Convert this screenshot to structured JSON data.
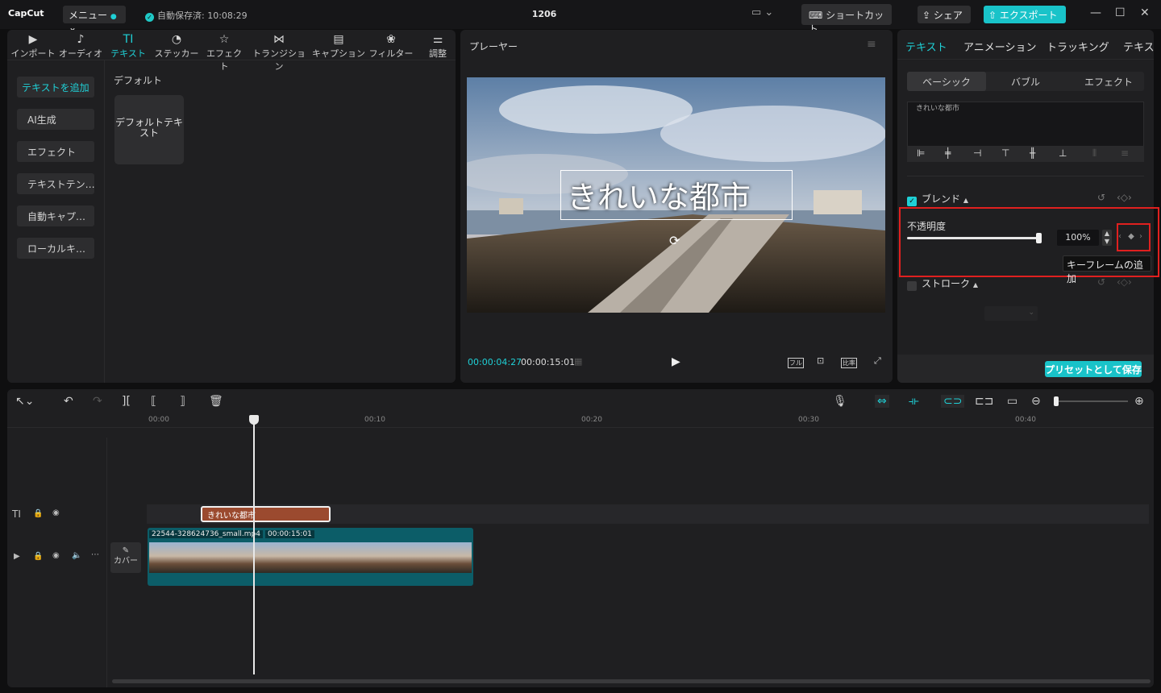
{
  "app": {
    "logo": "CapCut",
    "menu_label": "メニュー",
    "autosave": "自動保存済: 10:08:29",
    "project_title": "1206",
    "shortcut_label": "ショートカット",
    "share_label": "シェア",
    "export_label": "エクスポート"
  },
  "media_tabs": [
    {
      "label": "インポート",
      "icon": "import-icon"
    },
    {
      "label": "オーディオ",
      "icon": "audio-icon"
    },
    {
      "label": "テキスト",
      "icon": "text-icon"
    },
    {
      "label": "ステッカー",
      "icon": "sticker-icon"
    },
    {
      "label": "エフェクト",
      "icon": "effect-icon"
    },
    {
      "label": "トランジション",
      "icon": "transition-icon"
    },
    {
      "label": "キャプション",
      "icon": "caption-icon"
    },
    {
      "label": "フィルター",
      "icon": "filter-icon"
    },
    {
      "label": "調整",
      "icon": "adjust-icon"
    }
  ],
  "sidebar": [
    "テキストを追加",
    "AI生成",
    "エフェクト",
    "テキストテン…",
    "自動キャプ…",
    "ローカルキ…"
  ],
  "text_panel": {
    "section": "デフォルト",
    "card": "デフォルトテキスト"
  },
  "player": {
    "title": "プレーヤー",
    "overlay_text": "きれいな都市",
    "current_time": "00:00:04:27",
    "total_time": "00:00:15:01",
    "full_label": "フル",
    "ratio_label": "比率"
  },
  "props": {
    "tabs": [
      "テキスト",
      "アニメーション",
      "トラッキング",
      "テキスト"
    ],
    "subtabs": [
      "ベーシック",
      "バブル",
      "エフェクト"
    ],
    "text_value": "きれいな都市",
    "blend_label": "ブレンド",
    "opacity_label": "不透明度",
    "opacity_value": "100%",
    "opacity_fraction": 1.0,
    "tooltip": "キーフレームの追加",
    "stroke_label": "ストローク",
    "preset_label": "プリセットとして保存"
  },
  "timeline": {
    "ruler": [
      "00:00",
      "00:10",
      "00:20",
      "00:30",
      "00:40"
    ],
    "text_clip": "きれいな都市",
    "video_clip_name": "22544-328624736_small.mp4",
    "video_clip_duration": "00:00:15:01",
    "cover_label": "カバー"
  },
  "colors": {
    "accent": "#1fd0d6",
    "highlight": "#e0201f",
    "text_clip": "#9b4a2f",
    "video_clip": "#0c5d68"
  }
}
